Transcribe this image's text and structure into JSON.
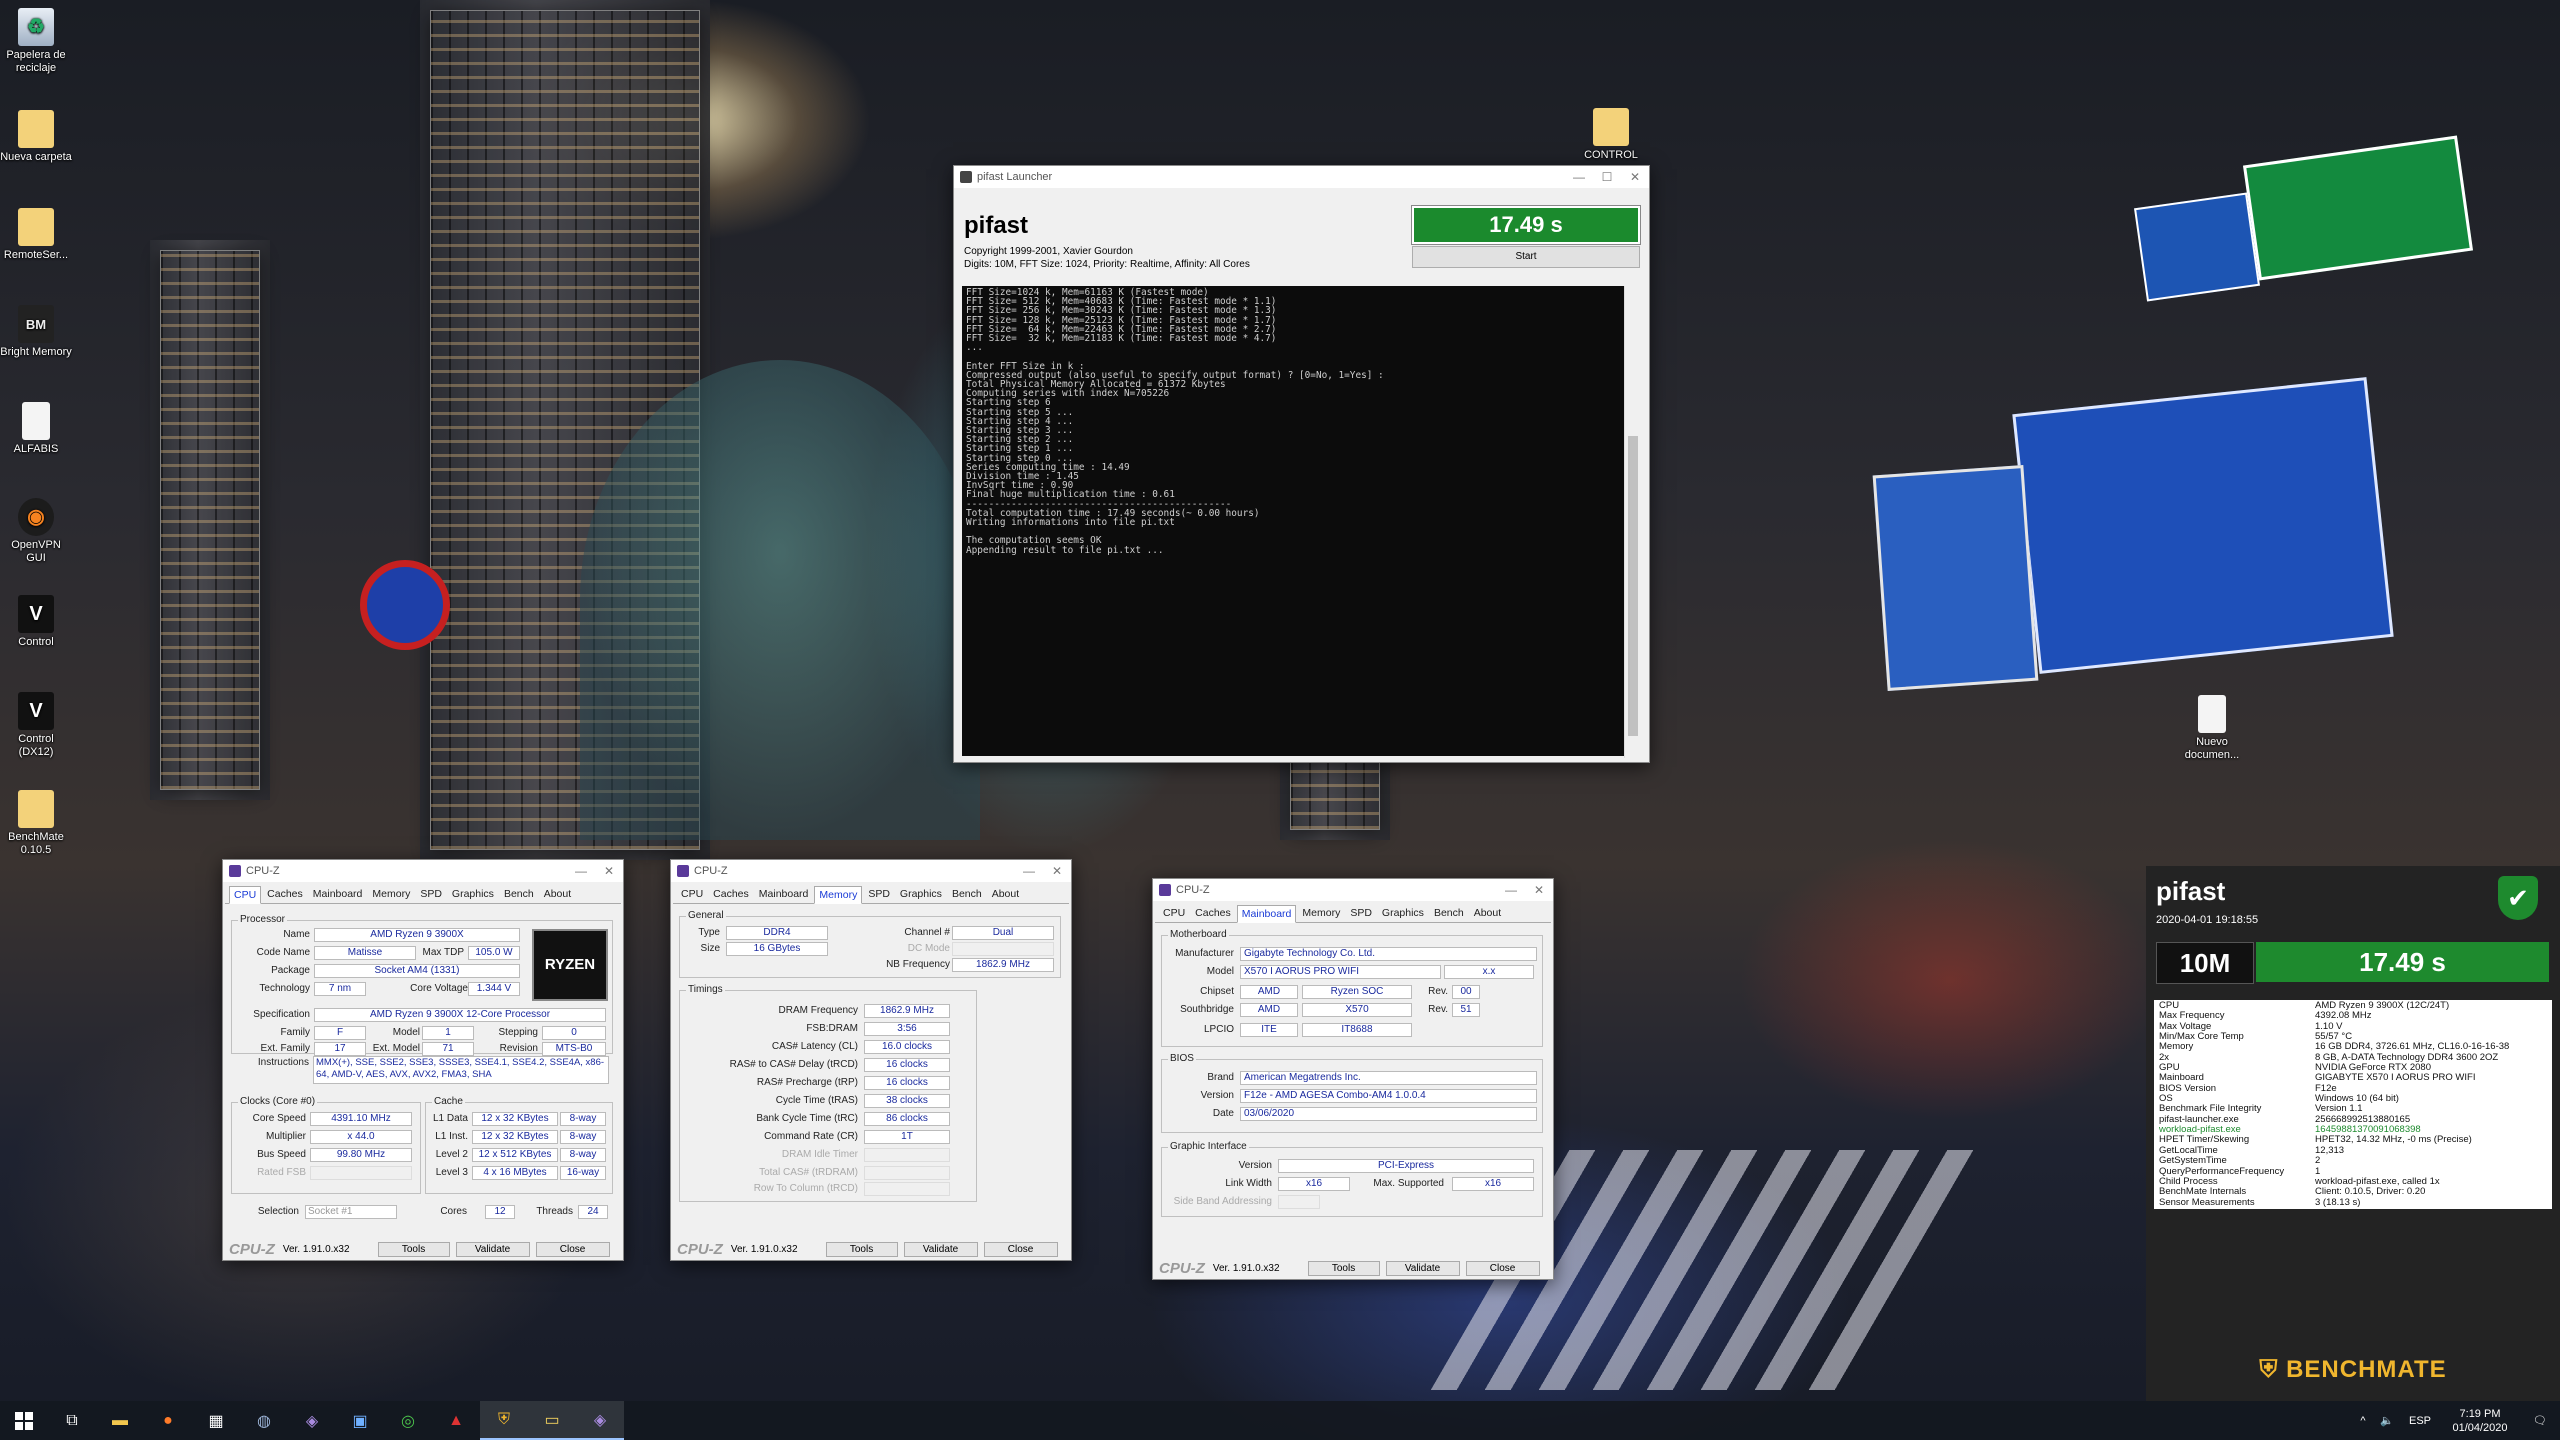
{
  "desktop_icons": [
    {
      "label": "Papelera de reciclaje",
      "icon": "recycle-bin-icon"
    },
    {
      "label": "Nueva carpeta",
      "icon": "folder-icon"
    },
    {
      "label": "RemoteSer...",
      "icon": "folder-icon"
    },
    {
      "label": "Bright Memory",
      "icon": "app-icon"
    },
    {
      "label": "ALFABIS",
      "icon": "document-icon"
    },
    {
      "label": "OpenVPN GUI",
      "icon": "openvpn-icon"
    },
    {
      "label": "Control",
      "icon": "app-icon"
    },
    {
      "label": "Control (DX12)",
      "icon": "app-icon"
    },
    {
      "label": "BenchMate 0.10.5",
      "icon": "folder-icon"
    },
    {
      "label": "CONTROL",
      "icon": "folder-icon"
    },
    {
      "label": "Nuevo documen...",
      "icon": "document-icon"
    }
  ],
  "pifast": {
    "window_title": "pifast Launcher",
    "app_name": "pifast",
    "copyright": "Copyright 1999-2001, Xavier Gourdon",
    "info": "Digits: 10M, FFT Size: 1024, Priority: Realtime, Affinity: All Cores",
    "time": "17.49 s",
    "start_label": "Start",
    "console": "FFT Size=1024 k, Mem=61163 K (Fastest mode)\nFFT Size= 512 k, Mem=40683 K (Time: Fastest mode * 1.1)\nFFT Size= 256 k, Mem=30243 K (Time: Fastest mode * 1.3)\nFFT Size= 128 k, Mem=25123 K (Time: Fastest mode * 1.7)\nFFT Size=  64 k, Mem=22463 K (Time: Fastest mode * 2.7)\nFFT Size=  32 k, Mem=21183 K (Time: Fastest mode * 4.7)\n...\n\nEnter FFT Size in k :\nCompressed output (also useful to specify output format) ? [0=No, 1=Yes] :\nTotal Physical Memory Allocated = 61372 Kbytes\nComputing series with index N=705226\nStarting step 6\nStarting step 5 ...\nStarting step 4 ...\nStarting step 3 ...\nStarting step 2 ...\nStarting step 1 ...\nStarting step 0 ...\nSeries computing time : 14.49\nDivision time : 1.45\nInvSqrt time : 0.90\nFinal huge multiplication time : 0.61\n-----------------------------------------------\nTotal computation time : 17.49 seconds(~ 0.00 hours)\nWriting informations into file pi.txt\n\nThe computation seems OK\nAppending result to file pi.txt ..."
  },
  "cpuz_common": {
    "title": "CPU-Z",
    "tabs": [
      "CPU",
      "Caches",
      "Mainboard",
      "Memory",
      "SPD",
      "Graphics",
      "Bench",
      "About"
    ],
    "brand": "CPU-Z",
    "version": "Ver. 1.91.0.x32",
    "tools": "Tools",
    "validate": "Validate",
    "close": "Close"
  },
  "cpuz_cpu": {
    "processor_group": "Processor",
    "name_label": "Name",
    "name": "AMD Ryzen 9 3900X",
    "codename_label": "Code Name",
    "codename": "Matisse",
    "maxtdp_label": "Max TDP",
    "maxtdp": "105.0 W",
    "package_label": "Package",
    "package": "Socket AM4 (1331)",
    "technology_label": "Technology",
    "technology": "7 nm",
    "corevoltage_label": "Core Voltage",
    "corevoltage": "1.344 V",
    "spec_label": "Specification",
    "spec": "AMD Ryzen 9 3900X 12-Core Processor",
    "family_label": "Family",
    "family": "F",
    "model_label": "Model",
    "model": "1",
    "stepping_label": "Stepping",
    "stepping": "0",
    "extfamily_label": "Ext. Family",
    "extfamily": "17",
    "extmodel_label": "Ext. Model",
    "extmodel": "71",
    "revision_label": "Revision",
    "revision": "MTS-B0",
    "instructions_label": "Instructions",
    "instructions": "MMX(+), SSE, SSE2, SSE3, SSSE3, SSE4.1, SSE4.2, SSE4A, x86-64, AMD-V, AES, AVX, AVX2, FMA3, SHA",
    "clocks_group": "Clocks (Core #0)",
    "corespeed_label": "Core Speed",
    "corespeed": "4391.10 MHz",
    "multiplier_label": "Multiplier",
    "multiplier": "x 44.0",
    "busspeed_label": "Bus Speed",
    "busspeed": "99.80 MHz",
    "ratedfsb_label": "Rated FSB",
    "cache_group": "Cache",
    "l1d_label": "L1 Data",
    "l1d": "12 x 32 KBytes",
    "l1d_way": "8-way",
    "l1i_label": "L1 Inst.",
    "l1i": "12 x 32 KBytes",
    "l1i_way": "8-way",
    "l2_label": "Level 2",
    "l2": "12 x 512 KBytes",
    "l2_way": "8-way",
    "l3_label": "Level 3",
    "l3": "4 x 16 MBytes",
    "l3_way": "16-way",
    "selection_label": "Selection",
    "selection": "Socket #1",
    "cores_label": "Cores",
    "cores": "12",
    "threads_label": "Threads",
    "threads": "24"
  },
  "cpuz_mem": {
    "general_group": "General",
    "type_label": "Type",
    "type": "DDR4",
    "channel_label": "Channel #",
    "channel": "Dual",
    "size_label": "Size",
    "size": "16 GBytes",
    "dcmode_label": "DC Mode",
    "nbfreq_label": "NB Frequency",
    "nbfreq": "1862.9 MHz",
    "timings_group": "Timings",
    "dram_label": "DRAM Frequency",
    "dram": "1862.9 MHz",
    "fsb_label": "FSB:DRAM",
    "fsb": "3:56",
    "cl_label": "CAS# Latency (CL)",
    "cl": "16.0 clocks",
    "trcd_label": "RAS# to CAS# Delay (tRCD)",
    "trcd": "16 clocks",
    "trp_label": "RAS# Precharge (tRP)",
    "trp": "16 clocks",
    "tras_label": "Cycle Time (tRAS)",
    "tras": "38 clocks",
    "trc_label": "Bank Cycle Time (tRC)",
    "trc": "86 clocks",
    "cr_label": "Command Rate (CR)",
    "cr": "1T",
    "idle_label": "DRAM Idle Timer",
    "trdram_label": "Total CAS# (tRDRAM)",
    "trcd2_label": "Row To Column (tRCD)"
  },
  "cpuz_mb": {
    "mb_group": "Motherboard",
    "manufacturer_label": "Manufacturer",
    "manufacturer": "Gigabyte Technology Co. Ltd.",
    "model_label": "Model",
    "model": "X570 I AORUS PRO WIFI",
    "model_rev": "x.x",
    "chipset_label": "Chipset",
    "chipset_vendor": "AMD",
    "chipset": "Ryzen SOC",
    "chipset_rev_label": "Rev.",
    "chipset_rev": "00",
    "southbridge_label": "Southbridge",
    "sb_vendor": "AMD",
    "sb": "X570",
    "sb_rev": "51",
    "lpcio_label": "LPCIO",
    "lpcio_vendor": "ITE",
    "lpcio": "IT8688",
    "bios_group": "BIOS",
    "brand_label": "Brand",
    "brand": "American Megatrends Inc.",
    "version_label": "Version",
    "version": "F12e - AMD AGESA Combo-AM4 1.0.0.4",
    "date_label": "Date",
    "date": "03/06/2020",
    "gi_group": "Graphic Interface",
    "gi_version_label": "Version",
    "gi_version": "PCI-Express",
    "linkwidth_label": "Link Width",
    "linkwidth": "x16",
    "maxsupported_label": "Max. Supported",
    "maxsupported": "x16",
    "sideband_label": "Side Band Addressing"
  },
  "benchmate": {
    "title": "pifast",
    "datetime": "2020-04-01 19:18:55",
    "variant": "10M",
    "time": "17.49 s",
    "rows": [
      [
        "CPU",
        "AMD Ryzen 9 3900X (12C/24T)"
      ],
      [
        "Max Frequency",
        "4392.08 MHz"
      ],
      [
        "Max Voltage",
        "1.10 V"
      ],
      [
        "Min/Max Core Temp",
        "55/57 °C"
      ],
      [
        "Memory",
        "16 GB DDR4, 3726.61 MHz, CL16.0-16-16-38"
      ],
      [
        "2x",
        "8 GB, A-DATA Technology DDR4 3600 2OZ"
      ],
      [
        "GPU",
        "NVIDIA GeForce RTX 2080"
      ],
      [
        "Mainboard",
        "GIGABYTE X570 I AORUS PRO WIFI"
      ],
      [
        "BIOS Version",
        "F12e"
      ],
      [
        "OS",
        "Windows 10 (64 bit)"
      ],
      [
        "Benchmark File Integrity",
        "Version 1.1"
      ],
      [
        "pifast-launcher.exe",
        "256668992513880165"
      ],
      [
        "workload-pifast.exe",
        "16459881370091068398"
      ],
      [
        "HPET Timer/Skewing",
        "HPET32, 14.32 MHz, -0 ms (Precise)"
      ],
      [
        "GetLocalTime",
        "12,313"
      ],
      [
        "GetSystemTime",
        "2"
      ],
      [
        "QueryPerformanceFrequency",
        "1"
      ],
      [
        "Child Process",
        "workload-pifast.exe, called 1x"
      ],
      [
        "BenchMate Internals",
        "Client: 0.10.5, Driver: 0.20"
      ],
      [
        "Sensor Measurements",
        "3 (18.13 s)"
      ]
    ],
    "logo": "BENCHMATE",
    "accent": "#1e8a2e"
  },
  "taskbar": {
    "time": "7:19 PM",
    "date": "01/04/2020",
    "lang": "ESP"
  }
}
